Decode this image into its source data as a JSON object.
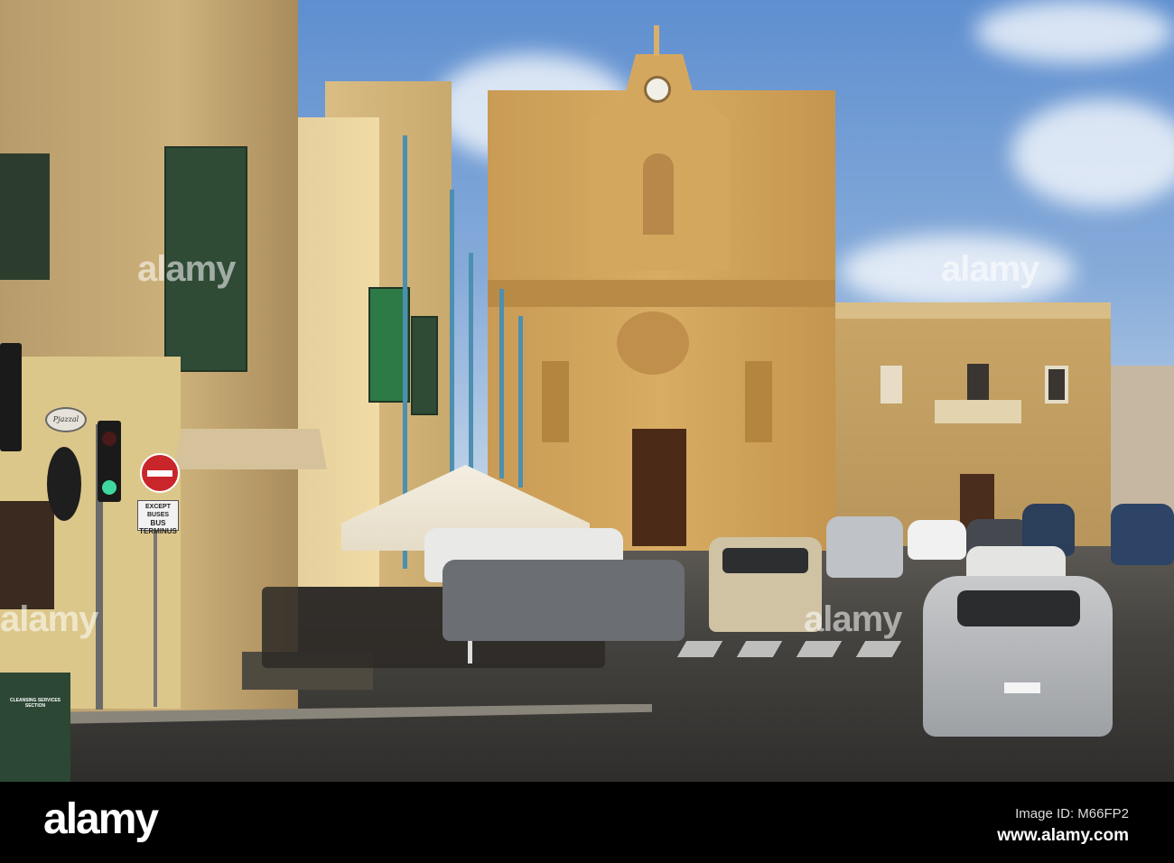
{
  "photo": {
    "shop_sign": "Pjazzal",
    "road_sign_except": "EXCEPT BUSES",
    "road_sign_main": "BUS TERMINUS",
    "bin_label": "CLEANSING SERVICES SECTION",
    "watermark": "alamy"
  },
  "footer": {
    "logo": "alamy",
    "image_id": "Image ID: M66FP2",
    "url": "www.alamy.com"
  }
}
